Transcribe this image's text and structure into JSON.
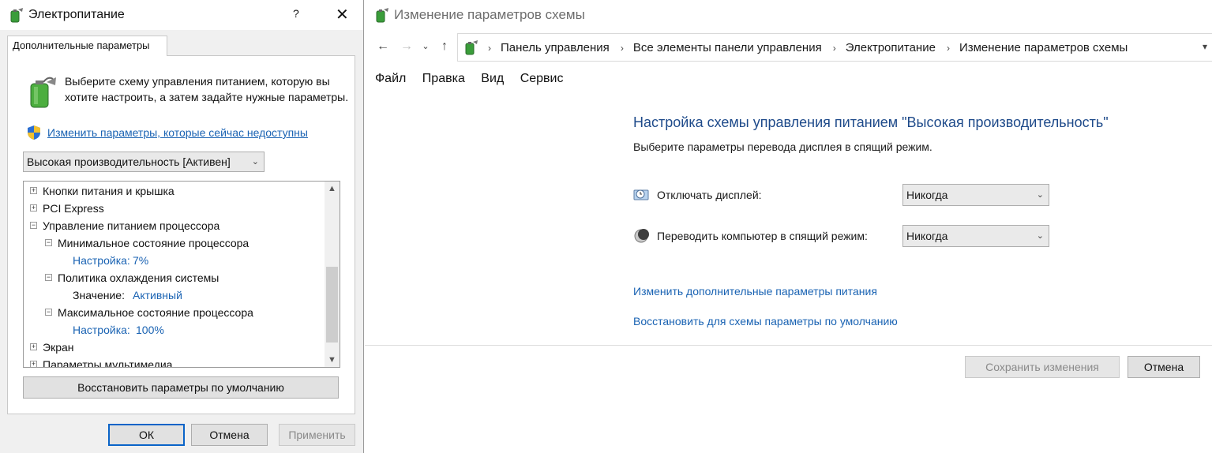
{
  "dialog": {
    "title": "Электропитание",
    "help_glyph": "?",
    "close_glyph": "✕",
    "tab_label": "Дополнительные параметры",
    "description": "Выберите схему управления питанием, которую вы хотите настроить, а затем задайте нужные параметры.",
    "change_link": "Изменить параметры, которые сейчас недоступны",
    "scheme_value": "Высокая производительность [Активен]",
    "tree": {
      "item1": "Кнопки питания и крышка",
      "item2": "PCI Express",
      "item3": "Управление питанием процессора",
      "item3_1": "Минимальное состояние процессора",
      "item3_1_setting_key": "Настройка:",
      "item3_1_setting_val": "7%",
      "item3_2": "Политика охлаждения системы",
      "item3_2_value_key": "Значение:",
      "item3_2_value_val": "Активный",
      "item3_3": "Максимальное состояние процессора",
      "item3_3_setting_key": "Настройка:",
      "item3_3_setting_val": "100%",
      "item4": "Экран",
      "item5": "Параметры мультимедиа"
    },
    "restore_defaults": "Восстановить параметры по умолчанию",
    "ok": "ОК",
    "cancel": "Отмена",
    "apply": "Применить"
  },
  "window": {
    "title": "Изменение параметров схемы",
    "breadcrumb": [
      "Панель управления",
      "Все элементы панели управления",
      "Электропитание",
      "Изменение параметров схемы"
    ],
    "menu": [
      "Файл",
      "Правка",
      "Вид",
      "Сервис"
    ],
    "heading": "Настройка схемы управления питанием \"Высокая производительность\"",
    "subtext": "Выберите параметры перевода дисплея в спящий режим.",
    "display_off_label": "Отключать дисплей:",
    "display_off_value": "Никогда",
    "sleep_label": "Переводить компьютер в спящий режим:",
    "sleep_value": "Никогда",
    "link_advanced": "Изменить дополнительные параметры питания",
    "link_restore": "Восстановить для схемы параметры по умолчанию",
    "save_button": "Сохранить изменения",
    "cancel_button": "Отмена"
  },
  "colors": {
    "link": "#1a63b3",
    "heading": "#1e4a8a",
    "default_button_border": "#0a64c8"
  },
  "icons": {
    "power_options": "battery-plug-icon",
    "shield": "uac-shield-icon",
    "display": "monitor-clock-icon",
    "sleep": "moon-icon"
  }
}
